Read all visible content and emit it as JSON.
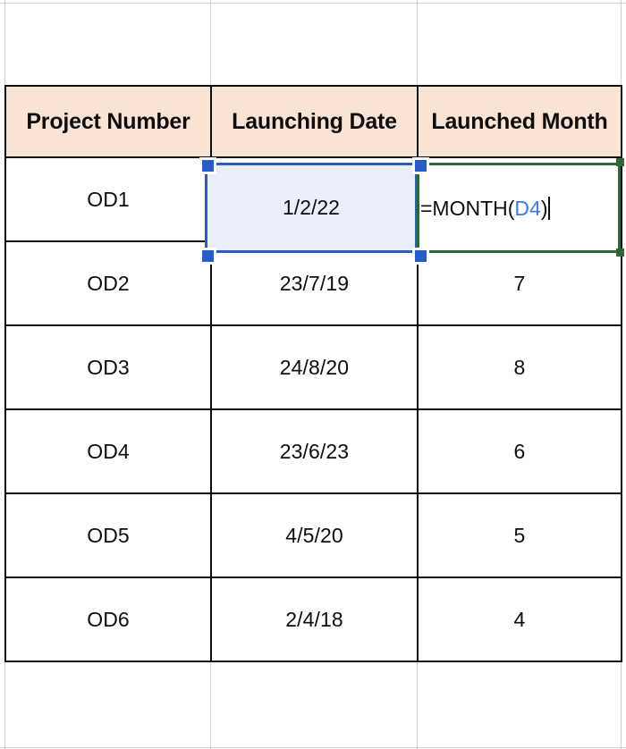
{
  "app": {
    "kind": "spreadsheet-cell-editing",
    "colors": {
      "header_fill": "#F8E3D5",
      "table_border": "#0D0D0D",
      "sheet_gridline": "#D0D0D0",
      "selection_border": "#2A5CC8",
      "selection_fill": "#E9EEF9",
      "editor_border": "#2B6A36",
      "formula_reference": "#3B78E7",
      "text": "#0D0D0D"
    }
  },
  "table": {
    "headers": [
      "Project Number",
      "Launching Date",
      "Launched Month"
    ],
    "rows": [
      {
        "project": "OD1",
        "date": "1/2/22",
        "month": ""
      },
      {
        "project": "OD2",
        "date": "23/7/19",
        "month": "7"
      },
      {
        "project": "OD3",
        "date": "24/8/20",
        "month": "8"
      },
      {
        "project": "OD4",
        "date": "23/6/23",
        "month": "6"
      },
      {
        "project": "OD5",
        "date": "4/5/20",
        "month": "5"
      },
      {
        "project": "OD6",
        "date": "2/4/18",
        "month": "4"
      }
    ]
  },
  "selection": {
    "selected_cell_value": "1/2/22",
    "handles": [
      "top-left",
      "top-right",
      "bottom-left",
      "bottom-right"
    ]
  },
  "editor": {
    "formula_prefix": "=MONTH(",
    "formula_reference": "D4",
    "formula_suffix": ")",
    "full_formula": "=MONTH(D4)",
    "caret_visible": true
  }
}
